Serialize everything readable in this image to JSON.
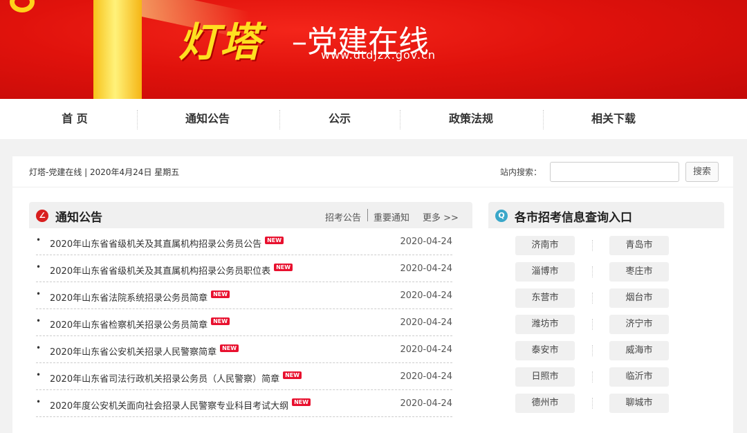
{
  "banner": {
    "logo_main": "灯塔",
    "logo_sub": "–党建在线",
    "url": "www.dtdjzx.gov.cn"
  },
  "nav": [
    "首 页",
    "通知公告",
    "公示",
    "政策法规",
    "相关下载"
  ],
  "info": {
    "date": "灯塔-党建在线 | 2020年4月24日 星期五",
    "search_label": "站内搜索：",
    "search_value": "",
    "search_button": "搜索"
  },
  "notice": {
    "title": "通知公告",
    "links": [
      "招考公告",
      "重要通知",
      "更多 >>"
    ],
    "new_badge": "NEW",
    "items": [
      {
        "title": "2020年山东省省级机关及其直属机构招录公务员公告",
        "date": "2020-04-24"
      },
      {
        "title": "2020年山东省省级机关及其直属机构招录公务员职位表",
        "date": "2020-04-24"
      },
      {
        "title": "2020年山东省法院系统招录公务员简章",
        "date": "2020-04-24"
      },
      {
        "title": "2020年山东省检察机关招录公务员简章",
        "date": "2020-04-24"
      },
      {
        "title": "2020年山东省公安机关招录人民警察简章",
        "date": "2020-04-24"
      },
      {
        "title": "2020年山东省司法行政机关招录公务员（人民警察）简章",
        "date": "2020-04-24"
      },
      {
        "title": "2020年度公安机关面向社会招录人民警察专业科目考试大纲",
        "date": "2020-04-24"
      }
    ]
  },
  "cities": {
    "title": "各市招考信息查询入口",
    "items": [
      "济南市",
      "青岛市",
      "淄博市",
      "枣庄市",
      "东营市",
      "烟台市",
      "潍坊市",
      "济宁市",
      "泰安市",
      "威海市",
      "日照市",
      "临沂市",
      "德州市",
      "聊城市"
    ]
  }
}
